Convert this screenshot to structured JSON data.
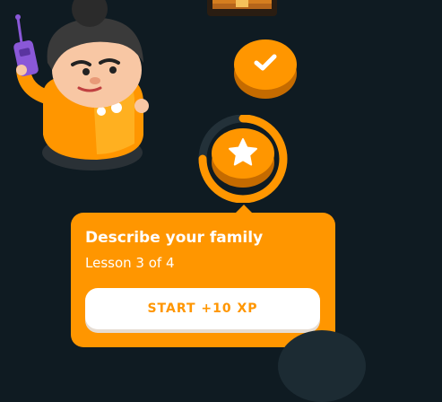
{
  "path": {
    "nodes": [
      {
        "state": "completed",
        "icon": "check-icon"
      },
      {
        "state": "current",
        "icon": "star-icon",
        "progress": 0.75
      },
      {
        "state": "locked"
      }
    ]
  },
  "popup": {
    "title": "Describe your family",
    "subtitle": "Lesson 3 of 4",
    "start_label": "START +10 XP"
  },
  "colors": {
    "background": "#0f1b22",
    "accent": "#ff9600",
    "accent_shadow": "#c56b00",
    "locked_node": "#1c2b33"
  }
}
